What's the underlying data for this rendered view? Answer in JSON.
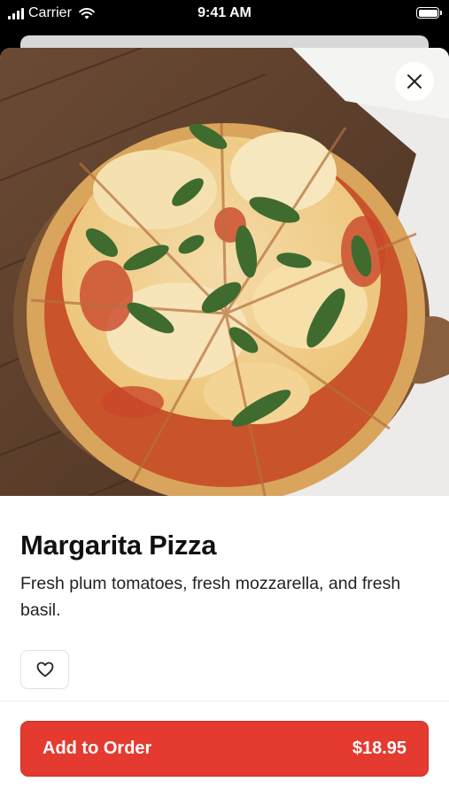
{
  "status_bar": {
    "carrier": "Carrier",
    "time": "9:41 AM",
    "icons": [
      "signal-icon",
      "wifi-icon",
      "battery-icon"
    ]
  },
  "product": {
    "image": "pizza-photo",
    "title": "Margarita Pizza",
    "description": "Fresh plum tomatoes, fresh mozzarella, and fresh basil."
  },
  "actions": {
    "close_icon": "close-icon",
    "favorite_icon": "heart-icon",
    "add_label": "Add to Order",
    "price": "$18.95"
  },
  "colors": {
    "accent": "#e43a2f",
    "text": "#111111"
  }
}
